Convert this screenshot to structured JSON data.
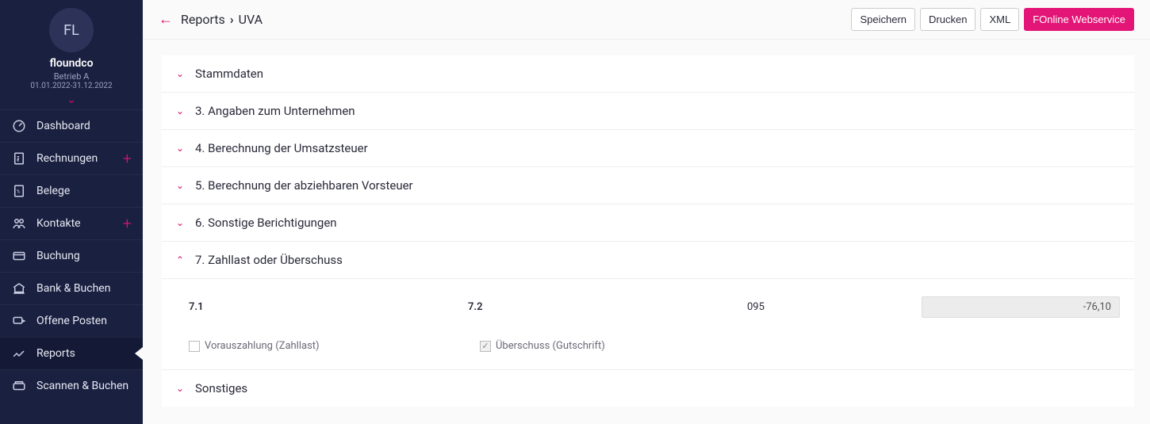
{
  "sidebar": {
    "avatar_initials": "FL",
    "company": "floundco",
    "subtitle": "Betrieb A",
    "period": "01.01.2022-31.12.2022",
    "items": [
      {
        "label": "Dashboard",
        "plus": false
      },
      {
        "label": "Rechnungen",
        "plus": true
      },
      {
        "label": "Belege",
        "plus": false
      },
      {
        "label": "Kontakte",
        "plus": true
      },
      {
        "label": "Buchung",
        "plus": false
      },
      {
        "label": "Bank & Buchen",
        "plus": false
      },
      {
        "label": "Offene Posten",
        "plus": false
      },
      {
        "label": "Reports",
        "plus": false,
        "active": true
      },
      {
        "label": "Scannen & Buchen",
        "plus": false
      }
    ]
  },
  "breadcrumb": {
    "root": "Reports",
    "current": "UVA"
  },
  "actions": {
    "save": "Speichern",
    "print": "Drucken",
    "xml": "XML",
    "webservice": "FOnline Webservice"
  },
  "sections": {
    "s1": "Stammdaten",
    "s2": "3. Angaben zum Unternehmen",
    "s3": "4. Berechnung der Umsatzsteuer",
    "s4": "5. Berechnung der abziehbaren Vorsteuer",
    "s5": "6. Sonstige Berichtigungen",
    "s6": "7. Zahllast oder Überschuss",
    "s7": "Sonstiges"
  },
  "section7": {
    "col71": "7.1",
    "col72": "7.2",
    "code": "095",
    "value": "-76,10",
    "cb71_label": "Vorauszahlung (Zahllast)",
    "cb72_label": "Überschuss (Gutschrift)"
  }
}
